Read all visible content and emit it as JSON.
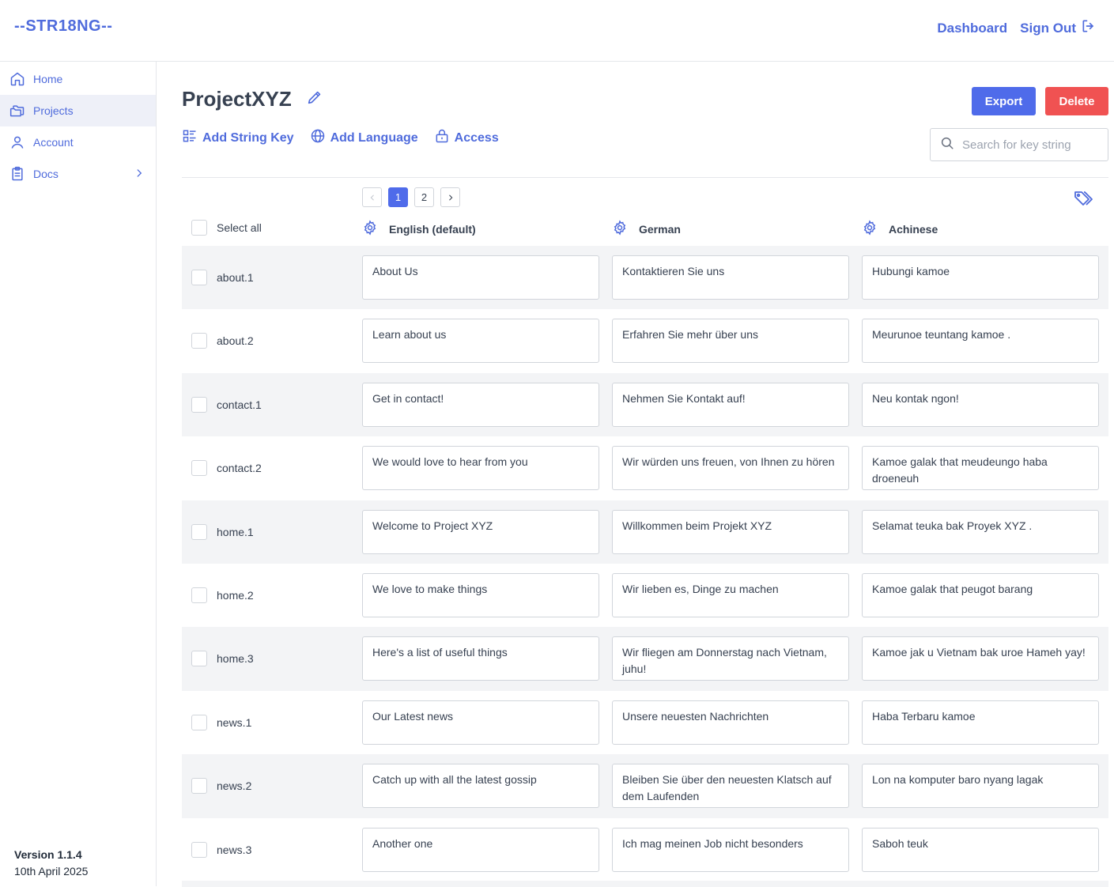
{
  "app": {
    "logo": "--STR18NG--"
  },
  "topnav": {
    "dashboard": "Dashboard",
    "signout": "Sign Out"
  },
  "sidebar": {
    "items": [
      {
        "label": "Home",
        "icon": "home-icon"
      },
      {
        "label": "Projects",
        "icon": "folders-icon",
        "active": true
      },
      {
        "label": "Account",
        "icon": "user-icon"
      },
      {
        "label": "Docs",
        "icon": "clipboard-icon"
      }
    ],
    "version": "Version 1.1.4",
    "date": "10th April 2025"
  },
  "project": {
    "title": "ProjectXYZ"
  },
  "buttons": {
    "export": "Export",
    "delete": "Delete"
  },
  "actions": {
    "add_key": "Add String Key",
    "add_language": "Add Language",
    "access": "Access"
  },
  "search": {
    "placeholder": "Search for key string",
    "value": ""
  },
  "pagination": {
    "pages": [
      "1",
      "2"
    ],
    "current": "1"
  },
  "table": {
    "select_all": "Select all",
    "languages": [
      "English (default)",
      "German",
      "Achinese"
    ],
    "rows": [
      {
        "key": "about.1",
        "values": [
          "About Us",
          "Kontaktieren Sie uns",
          "Hubungi kamoe"
        ]
      },
      {
        "key": "about.2",
        "values": [
          "Learn about us",
          "Erfahren Sie mehr über uns",
          "Meurunoe teuntang kamoe ."
        ]
      },
      {
        "key": "contact.1",
        "values": [
          "Get in contact!",
          "Nehmen Sie Kontakt auf!",
          "Neu kontak ngon!"
        ]
      },
      {
        "key": "contact.2",
        "values": [
          "We would love to hear from you",
          "Wir würden uns freuen, von Ihnen zu hören",
          "Kamoe galak that meudeungo haba droeneuh"
        ]
      },
      {
        "key": "home.1",
        "values": [
          "Welcome to Project XYZ",
          "Willkommen beim Projekt XYZ",
          "Selamat teuka bak Proyek XYZ ."
        ]
      },
      {
        "key": "home.2",
        "values": [
          "We love to make things",
          "Wir lieben es, Dinge zu machen",
          "Kamoe galak that peugot barang"
        ]
      },
      {
        "key": "home.3",
        "values": [
          "Here's a list of useful things",
          "Wir fliegen am Donnerstag nach Vietnam, juhu!",
          "Kamoe jak u Vietnam bak uroe Hameh yay!"
        ]
      },
      {
        "key": "news.1",
        "values": [
          "Our Latest news",
          "Unsere neuesten Nachrichten",
          "Haba Terbaru kamoe"
        ]
      },
      {
        "key": "news.2",
        "values": [
          "Catch up with all the latest gossip",
          "Bleiben Sie über den neuesten Klatsch auf dem Laufenden",
          "Lon na komputer baro nyang lagak"
        ]
      },
      {
        "key": "news.3",
        "values": [
          "Another one",
          "Ich mag meinen Job nicht besonders",
          "Saboh teuk"
        ]
      }
    ]
  },
  "colors": {
    "accent": "#4f6bdc",
    "primary_button": "#4f6bea",
    "danger_button": "#f05252",
    "row_shade": "#f3f4f6"
  }
}
